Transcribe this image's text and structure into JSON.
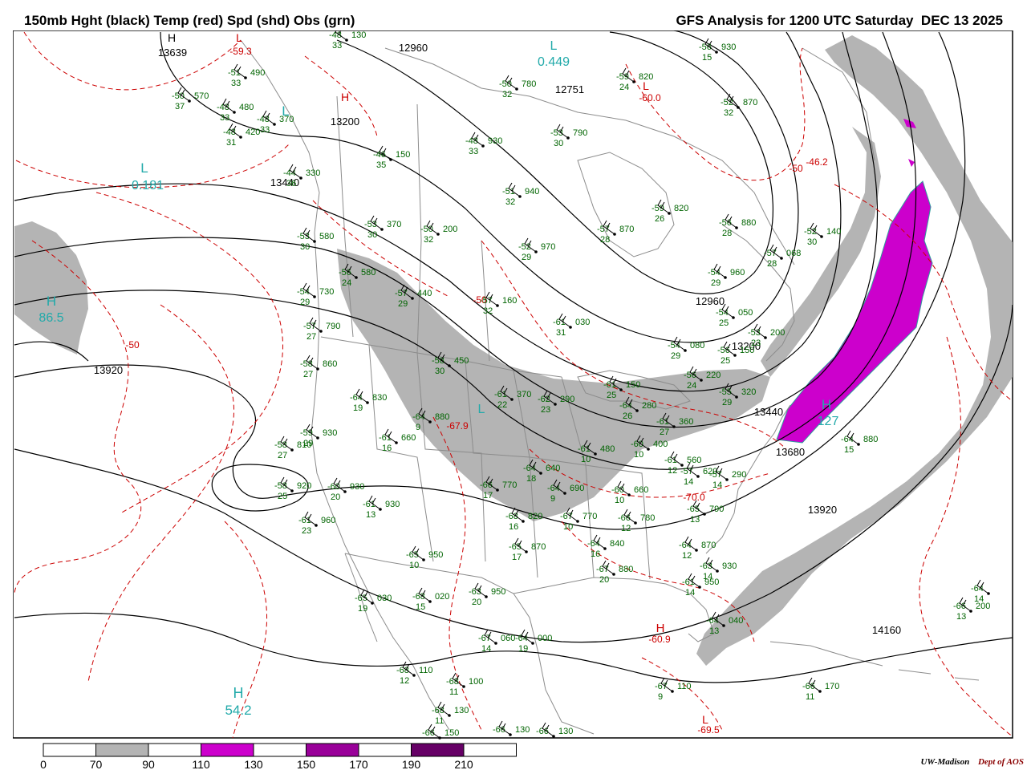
{
  "header": {
    "left_title": "150mb Hght (black) Temp (red) Spd (shd) Obs (grn)",
    "right_title": "GFS Analysis for 1200 UTC Saturday  DEC 13 2025"
  },
  "colors": {
    "height_contours": "#000000",
    "temperature_contours": "#cc0000",
    "observations": "#006400",
    "pressure_centers": "#22aaaa",
    "speed_70_90": "#b4b4b4",
    "speed_110_130": "#cc00cc",
    "speed_150_170": "#990099",
    "speed_190_210": "#660066",
    "borders": "#8c8c8c"
  },
  "height_labels": [
    "13639",
    "12960",
    "12751",
    "13200",
    "13440",
    "12960",
    "13200",
    "13440",
    "13680",
    "13920",
    "13920",
    "14160"
  ],
  "temperature_labels": [
    "-59.3",
    "-60.0",
    "-46.2",
    "-50",
    "-50",
    "-50",
    "-67.9",
    "-70.0",
    "-60.9",
    "-69.5"
  ],
  "centers": [
    {
      "letter": "H",
      "value": "",
      "kind": "height-high"
    },
    {
      "letter": "L",
      "value": "",
      "kind": "temp-low"
    },
    {
      "letter": "L",
      "value": "0.449",
      "kind": "speed-low"
    },
    {
      "letter": "L",
      "value": "0.181",
      "kind": "speed-low"
    },
    {
      "letter": "L",
      "value": "",
      "kind": "speed-low"
    },
    {
      "letter": "H",
      "value": "86.5",
      "kind": "speed-high"
    },
    {
      "letter": "H",
      "value": "127",
      "kind": "speed-high"
    },
    {
      "letter": "H",
      "value": "54.2",
      "kind": "speed-high"
    },
    {
      "letter": "L",
      "value": "",
      "kind": "speed-low"
    },
    {
      "letter": "H",
      "value": "",
      "kind": "temp-high"
    },
    {
      "letter": "L",
      "value": "",
      "kind": "temp-low"
    },
    {
      "letter": "H",
      "value": "",
      "kind": "temp-high"
    },
    {
      "letter": "L",
      "value": "",
      "kind": "temp-low"
    }
  ],
  "observations": [
    {
      "t": "-48",
      "h": "130",
      "d": "33"
    },
    {
      "t": "-51",
      "h": "490",
      "d": "33"
    },
    {
      "t": "-50",
      "h": "570",
      "d": "37"
    },
    {
      "t": "-48",
      "h": "480",
      "d": "33"
    },
    {
      "t": "-48",
      "h": "420",
      "d": "31"
    },
    {
      "t": "-48",
      "h": "370",
      "d": "33"
    },
    {
      "t": "-50",
      "h": "780",
      "d": "32"
    },
    {
      "t": "-53",
      "h": "790",
      "d": "30"
    },
    {
      "t": "-59",
      "h": "820",
      "d": "24"
    },
    {
      "t": "-56",
      "h": "930",
      "d": "15"
    },
    {
      "t": "-52",
      "h": "870",
      "d": "32"
    },
    {
      "t": "-48",
      "h": "930",
      "d": "33"
    },
    {
      "t": "-46",
      "h": "150",
      "d": "35"
    },
    {
      "t": "-44",
      "h": "330",
      "d": "36"
    },
    {
      "t": "-51",
      "h": "940",
      "d": "32"
    },
    {
      "t": "-59",
      "h": "820",
      "d": "26"
    },
    {
      "t": "-56",
      "h": "880",
      "d": "28"
    },
    {
      "t": "-53",
      "h": "370",
      "d": "30"
    },
    {
      "t": "-50",
      "h": "200",
      "d": "32"
    },
    {
      "t": "-52",
      "h": "970",
      "d": "29"
    },
    {
      "t": "-57",
      "h": "870",
      "d": "28"
    },
    {
      "t": "-57",
      "h": "068",
      "d": "28"
    },
    {
      "t": "-52",
      "h": "140",
      "d": "30"
    },
    {
      "t": "-53",
      "h": "580",
      "d": "30"
    },
    {
      "t": "-56",
      "h": "580",
      "d": "24"
    },
    {
      "t": "-57",
      "h": "440",
      "d": "29"
    },
    {
      "t": "-57",
      "h": "160",
      "d": "32"
    },
    {
      "t": "-54",
      "h": "960",
      "d": "29"
    },
    {
      "t": "-54",
      "h": "730",
      "d": "29"
    },
    {
      "t": "-57",
      "h": "790",
      "d": "27"
    },
    {
      "t": "-61",
      "h": "030",
      "d": "31"
    },
    {
      "t": "-54",
      "h": "050",
      "d": "25"
    },
    {
      "t": "-58",
      "h": "860",
      "d": "27"
    },
    {
      "t": "-58",
      "h": "450",
      "d": "30"
    },
    {
      "t": "-54",
      "h": "080",
      "d": "29"
    },
    {
      "t": "-53",
      "h": "200",
      "d": "23"
    },
    {
      "t": "-56",
      "h": "150",
      "d": "25"
    },
    {
      "t": "-64",
      "h": "830",
      "d": "19"
    },
    {
      "t": "-61",
      "h": "370",
      "d": "22"
    },
    {
      "t": "-62",
      "h": "290",
      "d": "23"
    },
    {
      "t": "-61",
      "h": "150",
      "d": "25"
    },
    {
      "t": "-56",
      "h": "220",
      "d": "24"
    },
    {
      "t": "-55",
      "h": "320",
      "d": "29"
    },
    {
      "t": "-59",
      "h": "930",
      "d": "29"
    },
    {
      "t": "-64",
      "h": "280",
      "d": "26"
    },
    {
      "t": "-61",
      "h": "360",
      "d": "27"
    },
    {
      "t": "-64",
      "h": "880",
      "d": "9"
    },
    {
      "t": "-58",
      "h": "810",
      "d": "27"
    },
    {
      "t": "-61",
      "h": "660",
      "d": "16"
    },
    {
      "t": "-61",
      "h": "480",
      "d": "10"
    },
    {
      "t": "-60",
      "h": "400",
      "d": "10"
    },
    {
      "t": "-61",
      "h": "560",
      "d": "12"
    },
    {
      "t": "-57",
      "h": "620",
      "d": "14"
    },
    {
      "t": "-57",
      "h": "290",
      "d": "14"
    },
    {
      "t": "-58",
      "h": "920",
      "d": "25"
    },
    {
      "t": "-60",
      "h": "930",
      "d": "20"
    },
    {
      "t": "-66",
      "h": "770",
      "d": "17"
    },
    {
      "t": "-64",
      "h": "640",
      "d": "18"
    },
    {
      "t": "-64",
      "h": "690",
      "d": "9"
    },
    {
      "t": "-60",
      "h": "660",
      "d": "10"
    },
    {
      "t": "-61",
      "h": "930",
      "d": "13"
    },
    {
      "t": "-61",
      "h": "960",
      "d": "23"
    },
    {
      "t": "-65",
      "h": "790",
      "d": "13"
    },
    {
      "t": "-68",
      "h": "820",
      "d": "16"
    },
    {
      "t": "-67",
      "h": "770",
      "d": "10"
    },
    {
      "t": "-66",
      "h": "780",
      "d": "12"
    },
    {
      "t": "-65",
      "h": "870",
      "d": "17"
    },
    {
      "t": "-64",
      "h": "840",
      "d": "16"
    },
    {
      "t": "-64",
      "h": "870",
      "d": "12"
    },
    {
      "t": "-65",
      "h": "950",
      "d": "10"
    },
    {
      "t": "-67",
      "h": "880",
      "d": "20"
    },
    {
      "t": "-63",
      "h": "930",
      "d": "14"
    },
    {
      "t": "-65",
      "h": "030",
      "d": "19"
    },
    {
      "t": "-68",
      "h": "020",
      "d": "15"
    },
    {
      "t": "-63",
      "h": "950",
      "d": "20"
    },
    {
      "t": "-61",
      "h": "950",
      "d": "14"
    },
    {
      "t": "-67",
      "h": "060",
      "d": "14"
    },
    {
      "t": "-64",
      "h": "000",
      "d": "19"
    },
    {
      "t": "-64",
      "h": "040",
      "d": "13"
    },
    {
      "t": "-68",
      "h": "110",
      "d": "12"
    },
    {
      "t": "-68",
      "h": "100",
      "d": "11"
    },
    {
      "t": "-68",
      "h": "130",
      "d": "11"
    },
    {
      "t": "-67",
      "h": "110",
      "d": "9"
    },
    {
      "t": "-66",
      "h": "170",
      "d": "11"
    },
    {
      "t": "-64",
      "h": "880",
      "d": "15"
    },
    {
      "t": "-66",
      "h": "200",
      "d": "13"
    },
    {
      "t": "-64",
      "h": "",
      "d": "14"
    },
    {
      "t": "-66",
      "h": "150",
      "d": ""
    },
    {
      "t": "-66",
      "h": "130",
      "d": ""
    },
    {
      "t": "-66",
      "h": "130",
      "d": ""
    }
  ],
  "colorbar": {
    "ticks": [
      "0",
      "70",
      "90",
      "110",
      "130",
      "150",
      "170",
      "190",
      "210"
    ],
    "fills": [
      "#ffffff",
      "#b4b4b4",
      "#ffffff",
      "#cc00cc",
      "#ffffff",
      "#990099",
      "#ffffff",
      "#660066",
      "#ffffff"
    ]
  },
  "credit": {
    "institution": "UW-Madison",
    "department": "Dept of AOS"
  }
}
